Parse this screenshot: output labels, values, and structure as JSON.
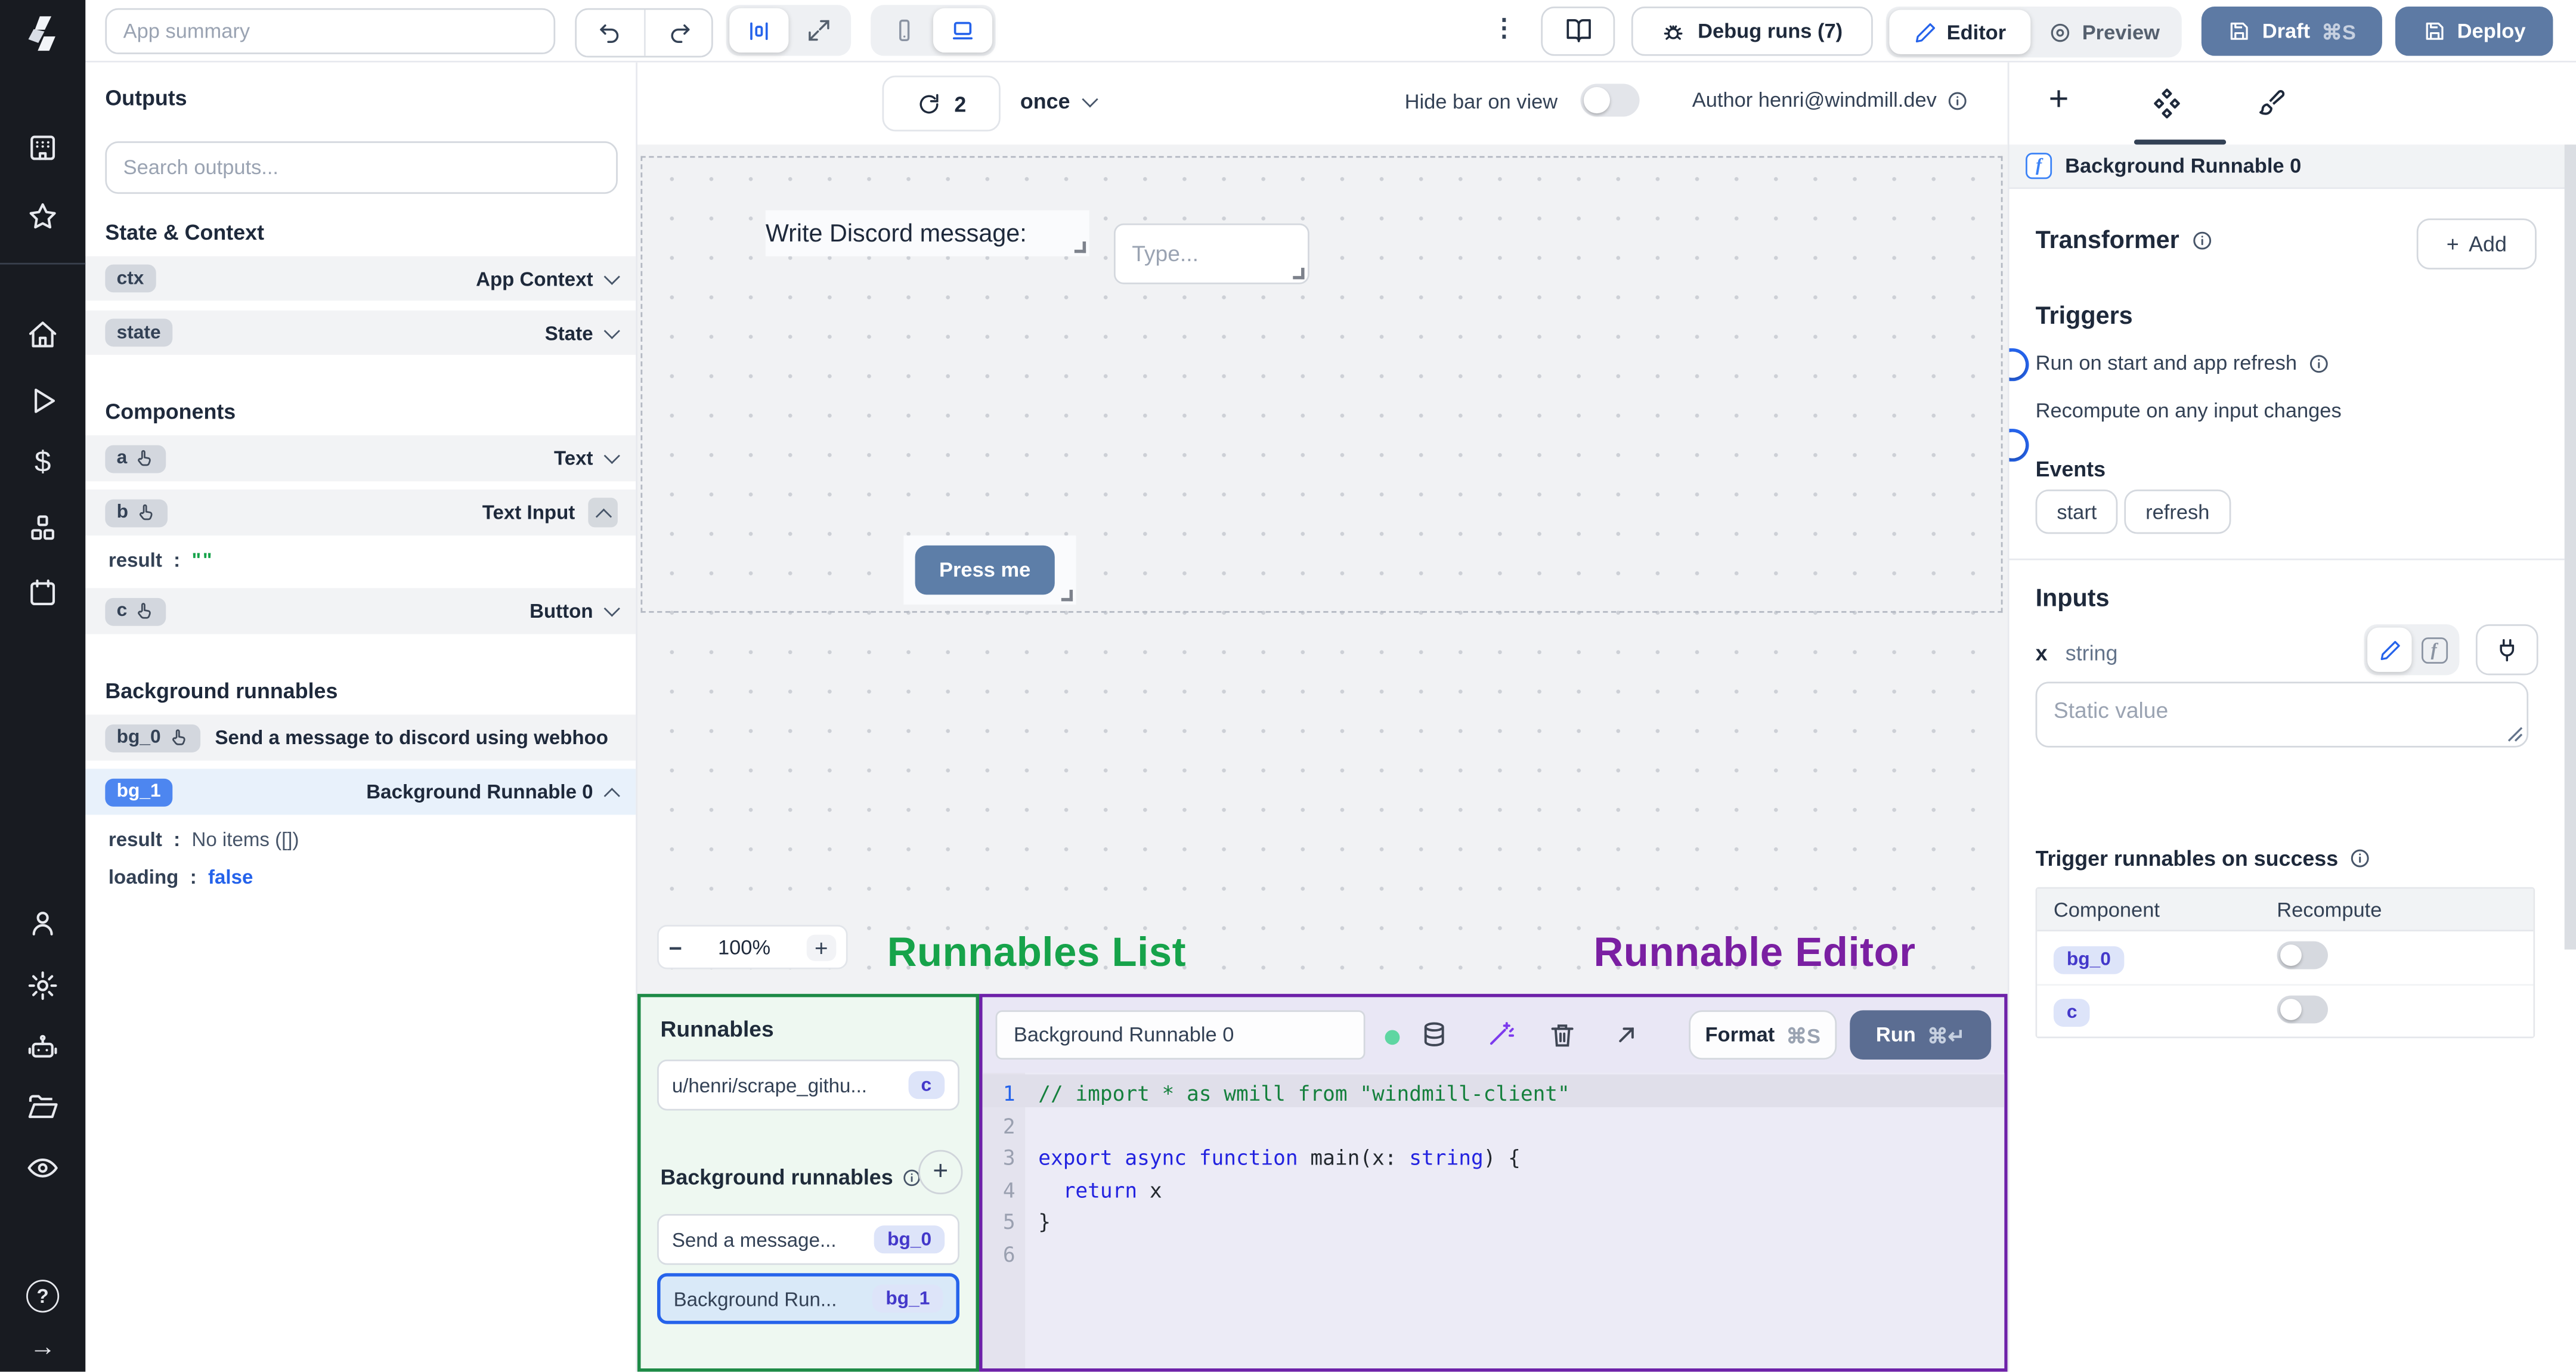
{
  "icons": {
    "kebab": "⋮",
    "dollar": "$",
    "help": "?",
    "arrow_right": "→",
    "plus": "+",
    "minus": "−",
    "cmd_s": "⌘S",
    "cmd_enter": "⌘↵"
  },
  "topbar": {
    "summary_placeholder": "App summary",
    "debug_runs": "Debug runs (7)",
    "editor": "Editor",
    "preview": "Preview",
    "draft": "Draft",
    "deploy": "Deploy"
  },
  "outputs": {
    "title": "Outputs",
    "search_placeholder": "Search outputs...",
    "sections": {
      "state": "State & Context",
      "components": "Components",
      "background": "Background runnables"
    },
    "ctx": {
      "badge": "ctx",
      "type": "App Context"
    },
    "state": {
      "badge": "state",
      "type": "State"
    },
    "a": {
      "badge": "a",
      "type": "Text"
    },
    "b": {
      "badge": "b",
      "type": "Text Input",
      "result_key": "result",
      "colon": ":",
      "result_value": "\"\""
    },
    "c": {
      "badge": "c",
      "type": "Button"
    },
    "bg0": {
      "badge": "bg_0",
      "label": "Send a message to discord using webhoo"
    },
    "bg1": {
      "badge": "bg_1",
      "label": "Background Runnable 0",
      "result_key": "result",
      "colon": ":",
      "result_value": "No items ([])",
      "loading_key": "loading",
      "loading_value": "false"
    }
  },
  "canvas": {
    "refresh_count": "2",
    "frequency": "once",
    "hide_bar": "Hide bar on view",
    "author": "Author henri@windmill.dev",
    "text_component": "Write Discord message:",
    "input_placeholder": "Type...",
    "button": "Press me",
    "zoom": "100%"
  },
  "annotations": {
    "list": "Runnables List",
    "editor": "Runnable Editor",
    "green": "#16a34a",
    "purple": "#7a1fa2"
  },
  "runnables": {
    "title": "Runnables",
    "bg_title": "Background runnables",
    "item_c": {
      "label": "u/henri/scrape_githu...",
      "badge": "c"
    },
    "item_bg0": {
      "label": "Send a message...",
      "badge": "bg_0"
    },
    "item_bg1": {
      "label": "Background Run...",
      "badge": "bg_1"
    }
  },
  "editor": {
    "name": "Background Runnable 0",
    "format": "Format",
    "run": "Run",
    "lines": [
      "1",
      "2",
      "3",
      "4",
      "5",
      "6"
    ],
    "code": {
      "l1": "// import * as wmill from \"windmill-client\"",
      "l3_kw": "export async function",
      "l3_mid": " main(x: ",
      "l3_type": "string",
      "l3_end": ") {",
      "l4_kw": "  return",
      "l4_end": " x",
      "l5": "}"
    }
  },
  "panel": {
    "header": "Background Runnable 0",
    "transformer": "Transformer",
    "add": "Add",
    "triggers": "Triggers",
    "run_on_start": "Run on start and app refresh",
    "recompute_any": "Recompute on any input changes",
    "events": "Events",
    "start": "start",
    "refresh": "refresh",
    "inputs": "Inputs",
    "input_name": "x",
    "input_type": "string",
    "static_placeholder": "Static value",
    "trigger_success": "Trigger runnables on success",
    "table": {
      "component": "Component",
      "recompute": "Recompute",
      "row1": "bg_0",
      "row2": "c"
    }
  }
}
